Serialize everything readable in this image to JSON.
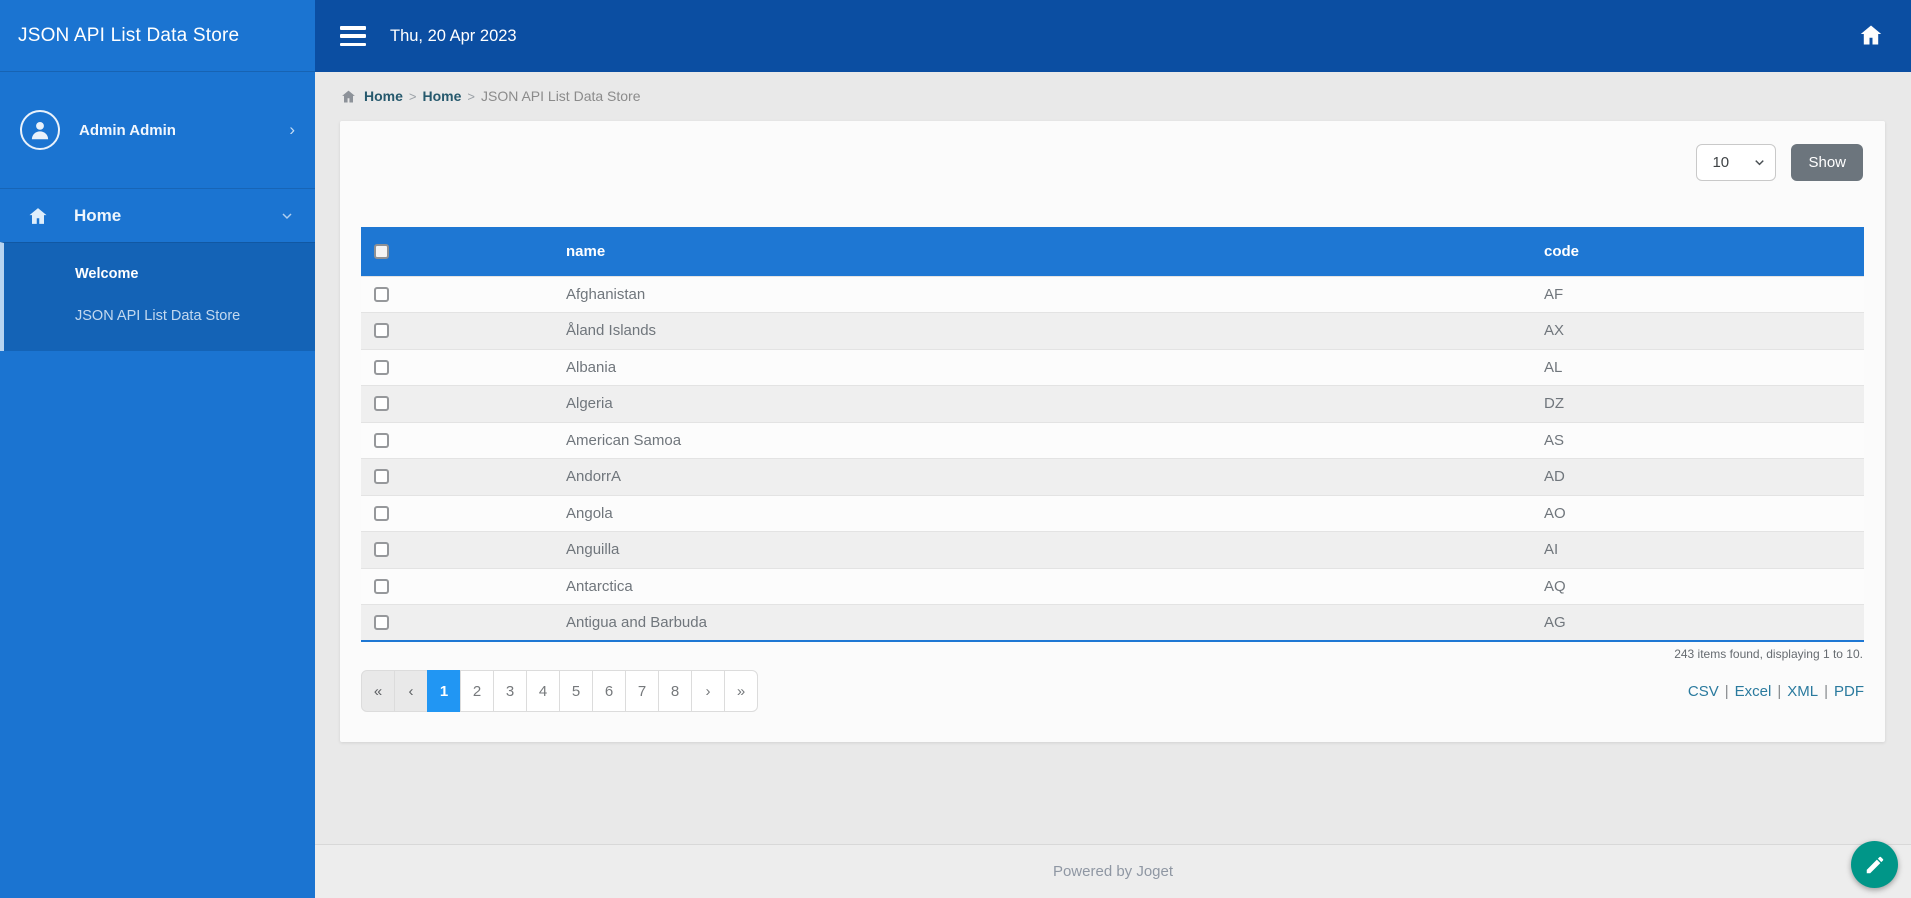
{
  "app": {
    "title": "JSON API List Data Store"
  },
  "topbar": {
    "date": "Thu, 20 Apr 2023"
  },
  "sidebar": {
    "user": {
      "name": "Admin Admin"
    },
    "menu": {
      "home_label": "Home",
      "items": [
        {
          "label": "Welcome"
        },
        {
          "label": "JSON API List Data Store"
        }
      ]
    }
  },
  "breadcrumb": {
    "separator": ">",
    "links": [
      "Home",
      "Home"
    ],
    "current": "JSON API List Data Store"
  },
  "toolbar": {
    "page_size": "10",
    "show_label": "Show"
  },
  "table": {
    "columns": {
      "name": "name",
      "code": "code"
    },
    "rows": [
      {
        "name": "Afghanistan",
        "code": "AF"
      },
      {
        "name": "Åland Islands",
        "code": "AX"
      },
      {
        "name": "Albania",
        "code": "AL"
      },
      {
        "name": "Algeria",
        "code": "DZ"
      },
      {
        "name": "American Samoa",
        "code": "AS"
      },
      {
        "name": "AndorrA",
        "code": "AD"
      },
      {
        "name": "Angola",
        "code": "AO"
      },
      {
        "name": "Anguilla",
        "code": "AI"
      },
      {
        "name": "Antarctica",
        "code": "AQ"
      },
      {
        "name": "Antigua and Barbuda",
        "code": "AG"
      }
    ]
  },
  "summary": "243 items found, displaying 1 to 10.",
  "pagination": {
    "first": "«",
    "prev": "‹",
    "pages": [
      "1",
      "2",
      "3",
      "4",
      "5",
      "6",
      "7",
      "8"
    ],
    "active_page": "1",
    "next": "›",
    "last": "»"
  },
  "export": {
    "separator": "|",
    "links": [
      "CSV",
      "Excel",
      "XML",
      "PDF"
    ]
  },
  "footer": {
    "text": "Powered by Joget"
  },
  "colors": {
    "sidebar_blue": "#1b74d1",
    "submenu_blue": "#1463b6",
    "topbar_blue": "#0b4ea2",
    "table_header_blue": "#1e77d3",
    "active_page_blue": "#2196f3",
    "fab_teal": "#009688",
    "link_teal": "#2a7a9e",
    "breadcrumb_link": "#26596d",
    "show_button_gray": "#6c757d"
  }
}
